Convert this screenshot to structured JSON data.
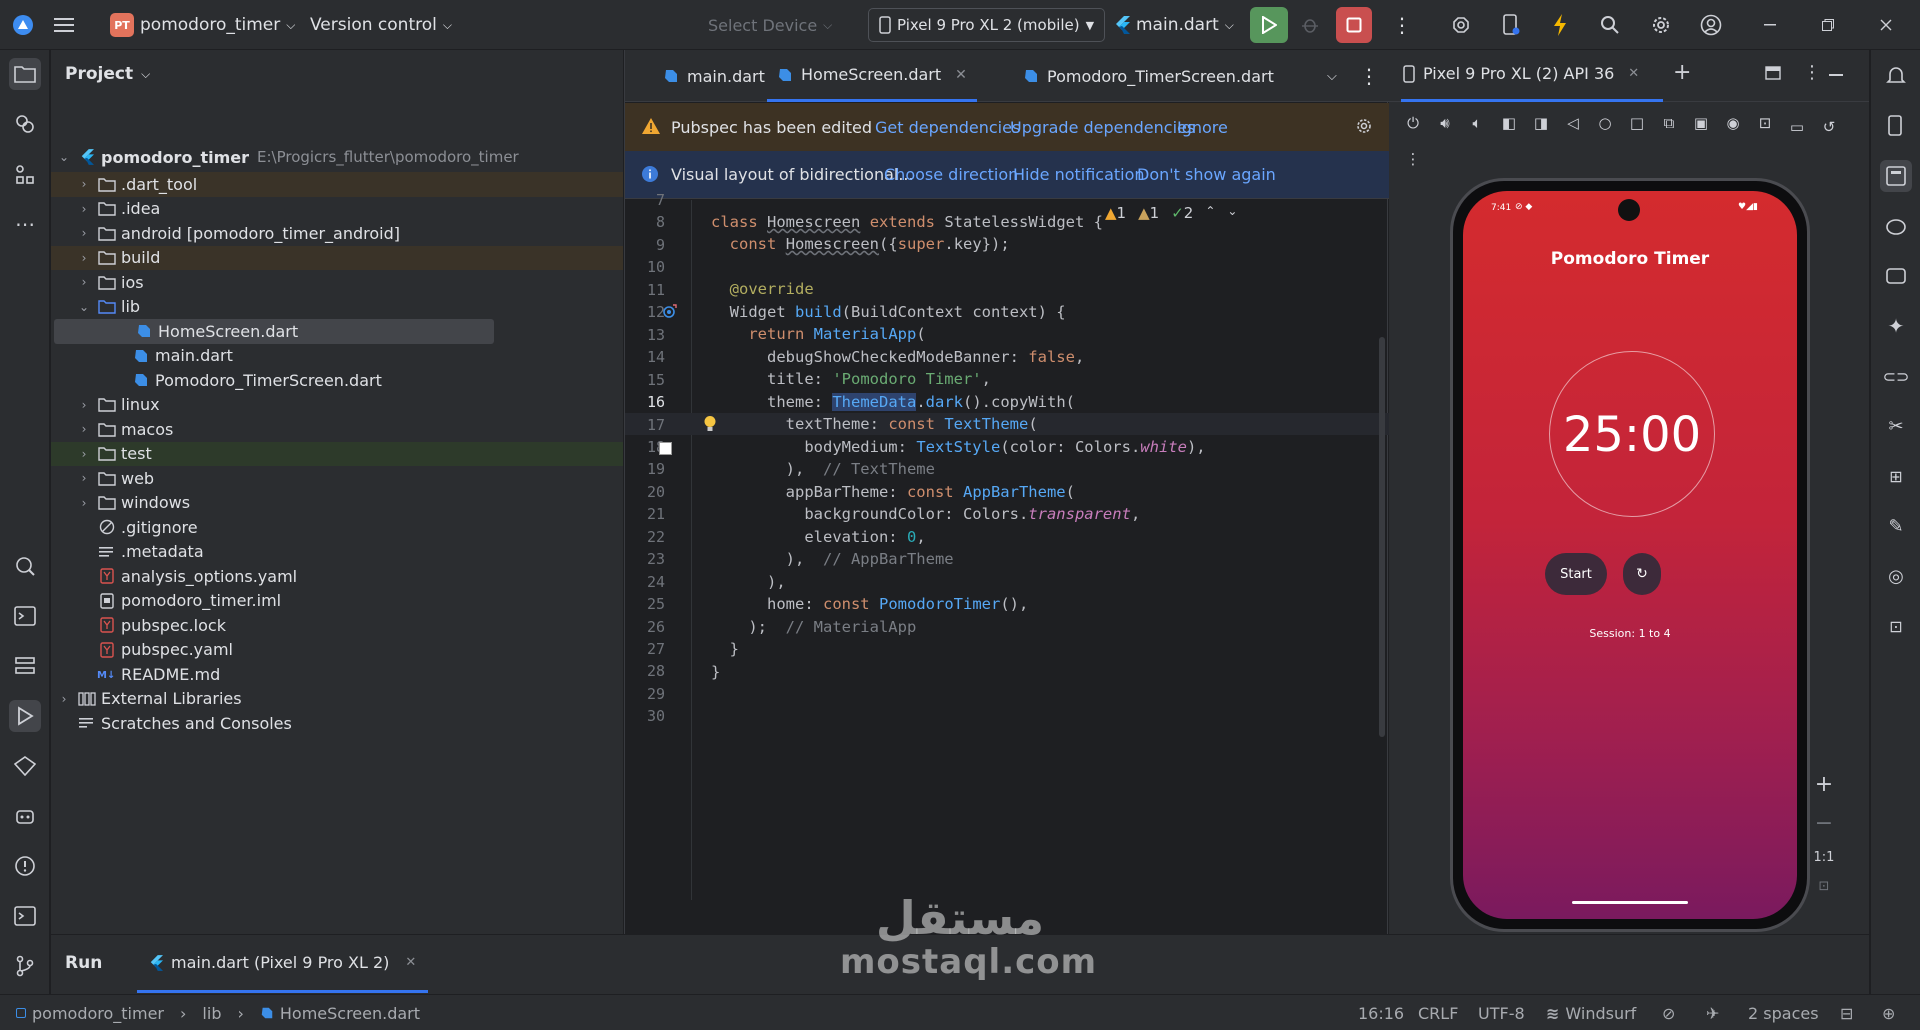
{
  "topbar": {
    "project_badge": "PT",
    "project_name": "pomodoro_timer",
    "version_control": "Version control",
    "select_device": "Select Device",
    "device": "Pixel 9 Pro XL 2 (mobile)",
    "run_config": "main.dart"
  },
  "project_panel": {
    "title": "Project",
    "root_name": "pomodoro_timer",
    "root_path": "E:\\Progicrs_flutter\\pomodoro_timer",
    "items": [
      {
        "label": ".dart_tool",
        "kind": "folder",
        "depth": 1
      },
      {
        "label": ".idea",
        "kind": "folder",
        "depth": 1
      },
      {
        "label": "android [pomodoro_timer_android]",
        "kind": "folder",
        "depth": 1
      },
      {
        "label": "build",
        "kind": "folder",
        "depth": 1
      },
      {
        "label": "ios",
        "kind": "folder",
        "depth": 1
      },
      {
        "label": "lib",
        "kind": "folder-open",
        "depth": 1
      },
      {
        "label": "HomeScreen.dart",
        "kind": "dart",
        "depth": 2
      },
      {
        "label": "main.dart",
        "kind": "dart",
        "depth": 2
      },
      {
        "label": "Pomodoro_TimerScreen.dart",
        "kind": "dart",
        "depth": 2
      },
      {
        "label": "linux",
        "kind": "folder",
        "depth": 1
      },
      {
        "label": "macos",
        "kind": "folder",
        "depth": 1
      },
      {
        "label": "test",
        "kind": "folder",
        "depth": 1
      },
      {
        "label": "web",
        "kind": "folder",
        "depth": 1
      },
      {
        "label": "windows",
        "kind": "folder",
        "depth": 1
      },
      {
        "label": ".gitignore",
        "kind": "ignore",
        "depth": 1
      },
      {
        "label": ".metadata",
        "kind": "text",
        "depth": 1
      },
      {
        "label": "analysis_options.yaml",
        "kind": "yaml",
        "depth": 1
      },
      {
        "label": "pomodoro_timer.iml",
        "kind": "iml",
        "depth": 1
      },
      {
        "label": "pubspec.lock",
        "kind": "yaml",
        "depth": 1
      },
      {
        "label": "pubspec.yaml",
        "kind": "yaml",
        "depth": 1
      },
      {
        "label": "README.md",
        "kind": "md",
        "depth": 1
      },
      {
        "label": "External Libraries",
        "kind": "lib",
        "depth": 0
      },
      {
        "label": "Scratches and Consoles",
        "kind": "scratch",
        "depth": 0
      }
    ]
  },
  "editor": {
    "tabs": [
      {
        "label": "main.dart"
      },
      {
        "label": "HomeScreen.dart"
      },
      {
        "label": "Pomodoro_TimerScreen.dart"
      }
    ],
    "notice1": {
      "text": "Pubspec has been edited",
      "get": "Get dependencies",
      "upgrade": "Upgrade dependencies",
      "ignore": "Ignore"
    },
    "notice2": {
      "text": "Visual layout of bidirectional...",
      "choose": "Choose direction",
      "hide": "Hide notification",
      "dont": "Don't show again"
    },
    "inspections": {
      "warnings": "1",
      "weak": "1",
      "ok": "2"
    },
    "line_numbers": [
      "7",
      "8",
      "9",
      "10",
      "11",
      "12",
      "13",
      "14",
      "15",
      "16",
      "17",
      "18",
      "19",
      "20",
      "21",
      "22",
      "23",
      "24",
      "25",
      "26",
      "27",
      "28",
      "29",
      "30"
    ]
  },
  "emulator": {
    "tab_title": "Pixel 9 Pro XL (2) API 36",
    "status_time": "7:41",
    "app_title": "Pomodoro Timer",
    "timer": "25:00",
    "start": "Start",
    "session": "Session: 1 to 4",
    "zoom_label": "1:1"
  },
  "runbar": {
    "run_label": "Run",
    "run_tab": "main.dart (Pixel 9 Pro XL 2)"
  },
  "statusbar": {
    "crumbs": [
      "pomodoro_timer",
      "lib",
      "HomeScreen.dart"
    ],
    "position": "16:16",
    "line_sep": "CRLF",
    "encoding": "UTF-8",
    "windsurf": "Windsurf",
    "indent": "2 spaces"
  },
  "watermark": {
    "arabic": "مستقل",
    "latin": "mostaql.com"
  },
  "colors": {
    "accent": "#3574f0",
    "run": "#57965c",
    "stop": "#c94f4f",
    "warning_bg": "#3d3223",
    "info_bg": "#25324d"
  }
}
